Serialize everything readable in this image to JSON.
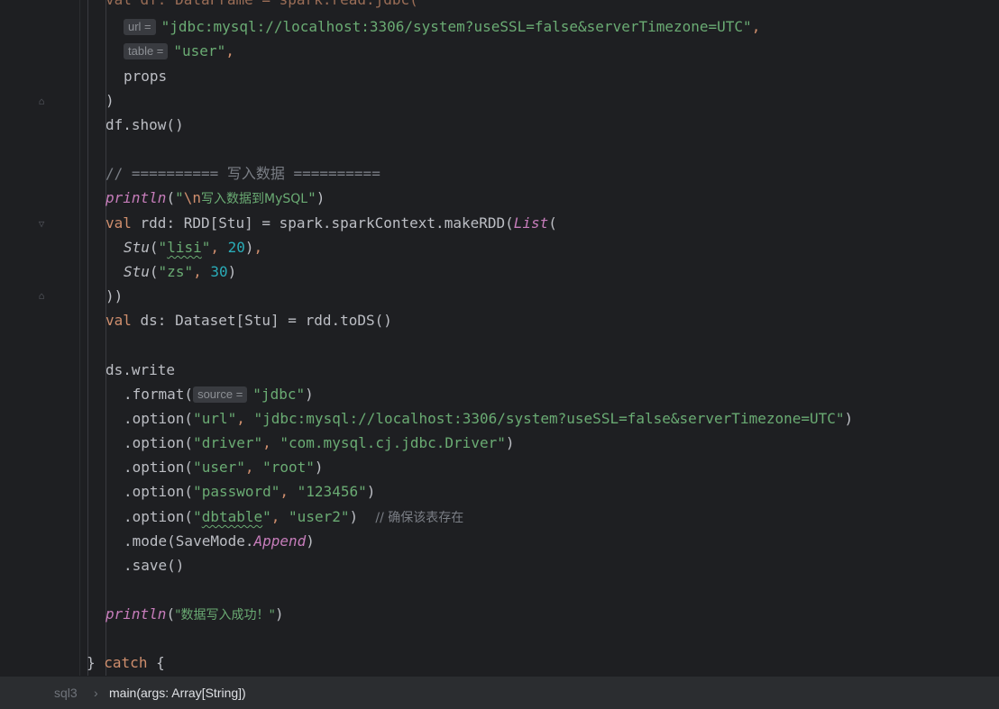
{
  "status_bar": {
    "file_crumb": "sql3",
    "separator": "›",
    "method_crumb": "main(args: Array[String])"
  },
  "code": {
    "top_partial": "val df: DataFrame = spark.read.jdbc(",
    "hint_url": "url =",
    "hint_table": "table =",
    "hint_source": "source =",
    "jdbc_url_literal": "\"jdbc:mysql://localhost:3306/system?useSSL=false&serverTimezone=UTC\"",
    "user_table_literal": "\"user\"",
    "props": "props",
    "close_paren": ")",
    "df_show": "df.show()",
    "section_comment": "// ========== 写入数据 ==========",
    "println": "println",
    "newline_escape": "\\n",
    "println_write_text": "写入数据到MySQL",
    "val_kw": "val",
    "rdd_decl": " rdd: RDD[Stu] = spark.sparkContext.makeRDD(",
    "list_fn": "List",
    "stu_fn": "Stu",
    "stu1_name": "lisi",
    "stu1_age": "20",
    "stu2_name": "\"zs\"",
    "stu2_age": "30",
    "close_list": "))",
    "ds_decl": " ds: Dataset[Stu] = rdd.toDS()",
    "ds_write": "ds.write",
    "format_call": ".format(",
    "jdbc_literal": "\"jdbc\"",
    "option_call": ".option(",
    "opt_url_key": "\"url\"",
    "opt_driver_key": "\"driver\"",
    "opt_driver_val": "\"com.mysql.cj.jdbc.Driver\"",
    "opt_user_key": "\"user\"",
    "opt_user_val": "\"root\"",
    "opt_password_key": "\"password\"",
    "opt_password_val": "\"123456\"",
    "opt_dbtable_key": "dbtable",
    "opt_dbtable_val": "\"user2\"",
    "dbtable_comment": "// 确保该表存在",
    "mode_call": ".mode(SaveMode.",
    "append": "Append",
    "save_call": ".save()",
    "success_text": "\"数据写入成功！\"",
    "catch_kw": "catch",
    "close_brace": "}",
    "open_brace": "{"
  }
}
